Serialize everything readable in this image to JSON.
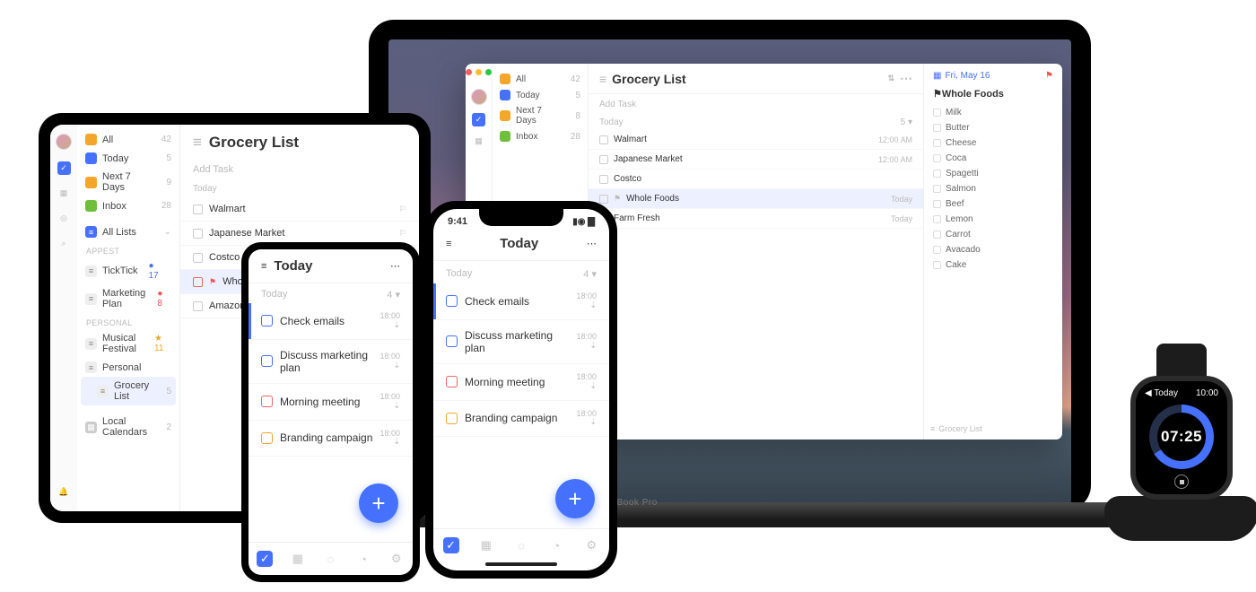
{
  "laptop": {
    "brand": "MacBook Pro",
    "window": {
      "lists": [
        {
          "icon": "ic-all",
          "label": "All",
          "count": 42
        },
        {
          "icon": "ic-today",
          "label": "Today",
          "count": 5
        },
        {
          "icon": "ic-next",
          "label": "Next 7 Days",
          "count": 8
        },
        {
          "icon": "ic-inbox",
          "label": "Inbox",
          "count": 28
        }
      ],
      "title": "Grocery List",
      "add_placeholder": "Add Task",
      "section": {
        "label": "Today",
        "count": "5 ▾"
      },
      "tasks": [
        {
          "title": "Walmart",
          "time": "12:00 AM"
        },
        {
          "title": "Japanese Market",
          "time": "12:00 AM"
        },
        {
          "title": "Costco",
          "time": ""
        },
        {
          "title": "Whole Foods",
          "time": "Today",
          "sel": true,
          "flag": true
        },
        {
          "title": "Farm Fresh",
          "time": "Today"
        }
      ],
      "detail": {
        "date": "Fri, May 16",
        "heading": "Whole Foods",
        "items": [
          "Milk",
          "Butter",
          "Cheese",
          "Coca",
          "Spagetti",
          "Salmon",
          "Beef",
          "Lemon",
          "Carrot",
          "Avacado",
          "Cake"
        ]
      },
      "footer_list": "Grocery List"
    }
  },
  "tablet": {
    "smart_lists": [
      {
        "icon": "ic-all",
        "label": "All",
        "count": 42
      },
      {
        "icon": "ic-today",
        "label": "Today",
        "count": 5
      },
      {
        "icon": "ic-next",
        "label": "Next 7 Days",
        "count": 9
      },
      {
        "icon": "ic-inbox",
        "label": "Inbox",
        "count": 28
      }
    ],
    "all_lists": {
      "label": "All Lists"
    },
    "groups": [
      {
        "title": "APPEST",
        "items": [
          {
            "label": "TickTick",
            "badge": "● 17",
            "badge_blue": true
          },
          {
            "label": "Marketing Plan",
            "badge": "● 8",
            "badge_red": true
          }
        ]
      },
      {
        "title": "Personal",
        "items": [
          {
            "label": "Musical Festival",
            "badge": "★ 11",
            "badge_orange": true
          },
          {
            "label": "Personal",
            "folder": true
          },
          {
            "label": "Grocery List",
            "count": 5,
            "indent": true,
            "sel": true
          }
        ]
      }
    ],
    "local_cal": {
      "label": "Local Calendars",
      "count": 2
    },
    "main": {
      "title": "Grocery List",
      "add_placeholder": "Add Task",
      "section": "Today",
      "tasks": [
        {
          "title": "Walmart"
        },
        {
          "title": "Japanese Market"
        },
        {
          "title": "Costco"
        },
        {
          "title": "Whole Foods",
          "flag": true,
          "red": true,
          "sel": true
        },
        {
          "title": "Amazon Fresh"
        }
      ]
    }
  },
  "android": {
    "hdr_title": "Today",
    "section": {
      "label": "Today",
      "count": "4 ▾"
    },
    "tasks": [
      {
        "title": "Check emails",
        "time": "18:00",
        "ck": "blue",
        "bar": true
      },
      {
        "title": "Discuss marketing plan",
        "time": "18:00",
        "ck": "blue"
      },
      {
        "title": "Morning meeting",
        "time": "18:00",
        "ck": "red"
      },
      {
        "title": "Branding campaign",
        "time": "18:00",
        "ck": "orange"
      }
    ]
  },
  "ios": {
    "status_time": "9:41",
    "hdr_title": "Today",
    "section": {
      "label": "Today",
      "count": "4 ▾"
    },
    "tasks": [
      {
        "title": "Check emails",
        "time": "18:00",
        "ck": "blue",
        "bar": true
      },
      {
        "title": "Discuss marketing plan",
        "time": "18:00",
        "ck": "blue"
      },
      {
        "title": "Morning meeting",
        "time": "18:00",
        "ck": "red"
      },
      {
        "title": "Branding campaign",
        "time": "18:00",
        "ck": "orange"
      }
    ]
  },
  "watch": {
    "back": "◀ Today",
    "clock": "10:00",
    "timer": "07:25"
  }
}
